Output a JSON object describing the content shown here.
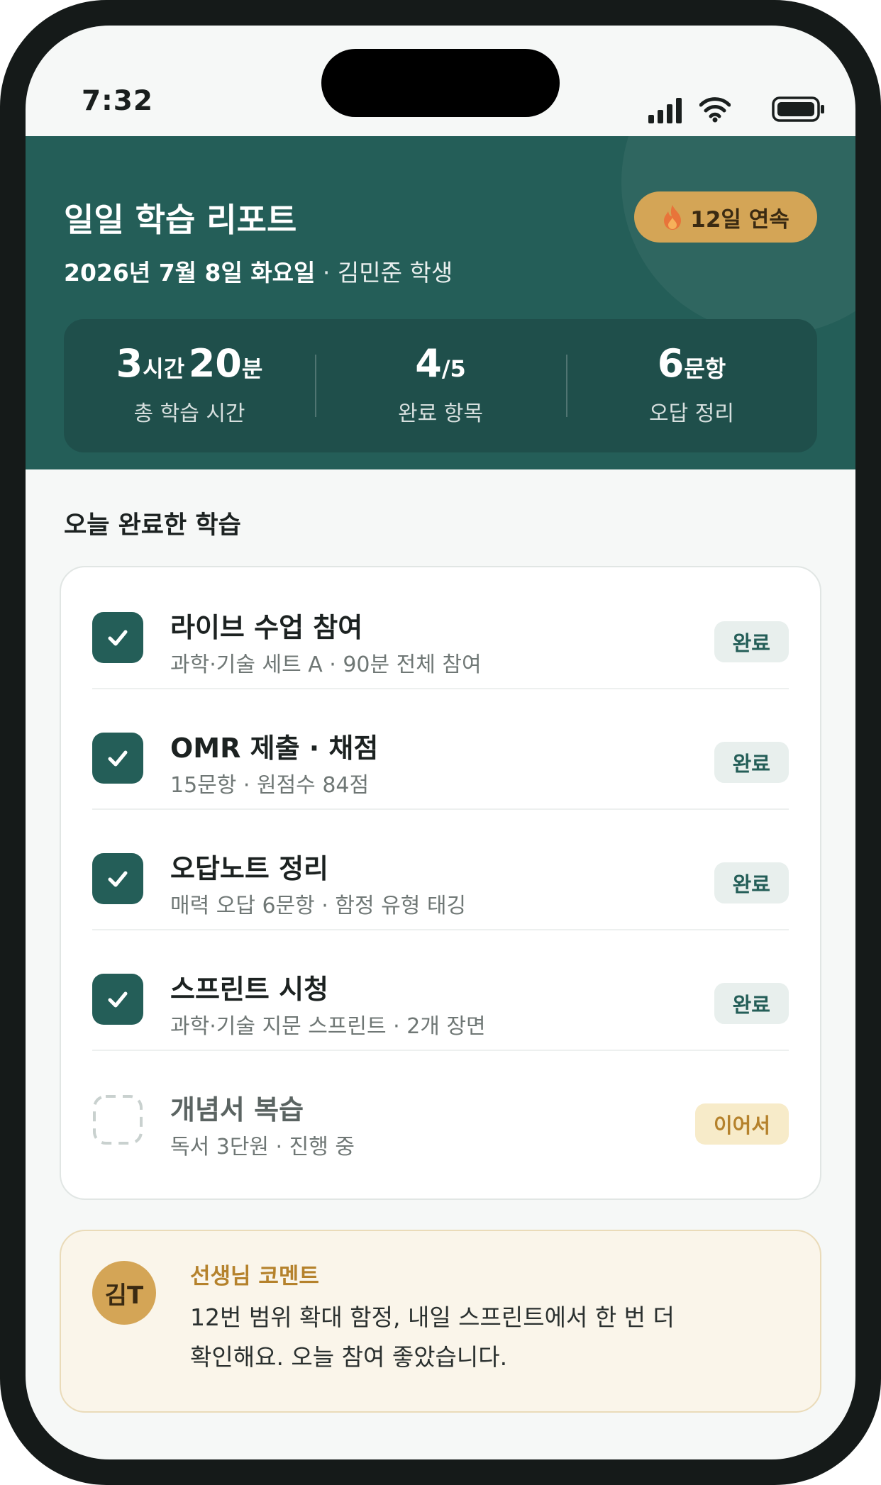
{
  "status_bar": {
    "time": "7:32"
  },
  "header": {
    "title": "일일 학습 리포트",
    "date": "2026년 7월 8일 화요일",
    "separator": "·",
    "student": "김민준 학생",
    "streak": {
      "icon": "flame-icon",
      "label": "12일 연속"
    },
    "stats": [
      {
        "value": "3",
        "unit": "시간",
        "value2": "20",
        "unit2": "분",
        "label": "총 학습 시간"
      },
      {
        "value": "4",
        "unit": "/5",
        "label": "완료 항목"
      },
      {
        "value": "6",
        "unit": "문항",
        "label": "오답 정리"
      }
    ]
  },
  "section_title": "오늘 완료한 학습",
  "tasks": [
    {
      "title": "라이브 수업 참여",
      "sub": "과학·기술 세트 A · 90분 전체 참여",
      "badge": "완료",
      "done": true
    },
    {
      "title": "OMR 제출 · 채점",
      "sub": "15문항 · 원점수 84점",
      "badge": "완료",
      "done": true
    },
    {
      "title": "오답노트 정리",
      "sub": "매력 오답 6문항 · 함정 유형 태깅",
      "badge": "완료",
      "done": true
    },
    {
      "title": "스프린트 시청",
      "sub": "과학·기술 지문 스프린트 · 2개 장면",
      "badge": "완료",
      "done": true
    },
    {
      "title": "개념서 복습",
      "sub": "독서 3단원 · 진행 중",
      "badge": "이어서",
      "done": false
    }
  ],
  "comment": {
    "avatar": "김T",
    "title": "선생님 코멘트",
    "line1": "12번 범위 확대 함정, 내일 스프린트에서 한 번 더",
    "line2": "확인해요. 오늘 참여 좋았습니다."
  },
  "colors": {
    "primary": "#245e58",
    "accent": "#d4a556",
    "background": "#f6f8f7"
  }
}
